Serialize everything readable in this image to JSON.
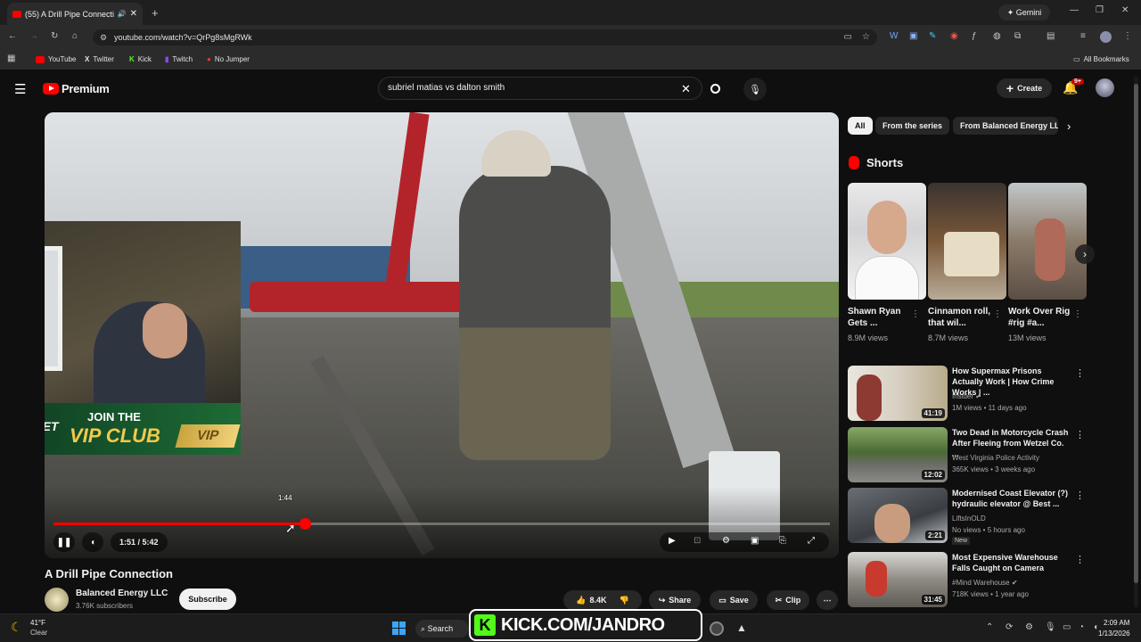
{
  "browser": {
    "tab_title": "(55) A Drill Pipe Connection",
    "url": "youtube.com/watch?v=QrPg8sMgRWk",
    "gemini_label": "Gemini",
    "all_bookmarks": "All Bookmarks",
    "bookmarks": [
      {
        "label": "YouTube"
      },
      {
        "label": "Twitter"
      },
      {
        "label": "Kick"
      },
      {
        "label": "Twitch"
      },
      {
        "label": "No Jumper"
      }
    ]
  },
  "youtube": {
    "logo_text": "Premium",
    "search_value": "subriel matias vs dalton smith",
    "create_label": "Create",
    "notif_count": "9+",
    "accent": "#ff0000"
  },
  "video": {
    "title": "A Drill Pipe Connection",
    "current_time": "1:51 / 5:42",
    "hover_time": "1:44",
    "progress_fraction": 0.324,
    "channel_name": "Balanced Energy LLC",
    "subscribers": "3.76K subscribers",
    "subscribe_label": "Subscribe",
    "likes": "8.4K",
    "share_label": "Share",
    "save_label": "Save",
    "clip_label": "Clip",
    "overlay_join": "JOIN THE",
    "overlay_vip": "VIP CLUB",
    "overlay_brand": "ACEBET",
    "overlay_badge": "VIP"
  },
  "chips": [
    "All",
    "From the series",
    "From Balanced Energy LLC"
  ],
  "shorts": {
    "header": "Shorts",
    "items": [
      {
        "title": "Shawn Ryan Gets ...",
        "views": "8.9M views"
      },
      {
        "title": "Cinnamon roll, that wil...",
        "views": "8.7M views"
      },
      {
        "title": "Work  Over Rig #rig #a...",
        "views": "13M views"
      }
    ]
  },
  "recommendations": [
    {
      "title": "How Supermax Prisons Actually Work | How Crime Works | ...",
      "channel": "Insider",
      "meta": "1M views • 11 days ago",
      "duration": "41:19",
      "badge": ""
    },
    {
      "title": "Two Dead in Motorcycle Crash After Fleeing from Wetzel Co. ...",
      "channel": "West Virginia Police Activity",
      "meta": "365K views • 3 weeks ago",
      "duration": "12:02",
      "badge": ""
    },
    {
      "title": "Modernised Coast Elevator (?) hydraulic elevator @ Best ...",
      "channel": "LiftsInOLD",
      "meta": "No views • 5 hours ago",
      "duration": "2:21",
      "badge": "New"
    },
    {
      "title": "Most Expensive Warehouse Falls Caught on Camera",
      "channel": "#Mind Warehouse",
      "meta": "718K views • 1 year ago",
      "duration": "31:45",
      "badge": ""
    }
  ],
  "taskbar": {
    "temp": "41°F",
    "weather": "Clear",
    "search": "Search",
    "time": "2:09 AM",
    "date": "1/13/2026",
    "kick_banner": "KICK.COM/JANDRO"
  }
}
